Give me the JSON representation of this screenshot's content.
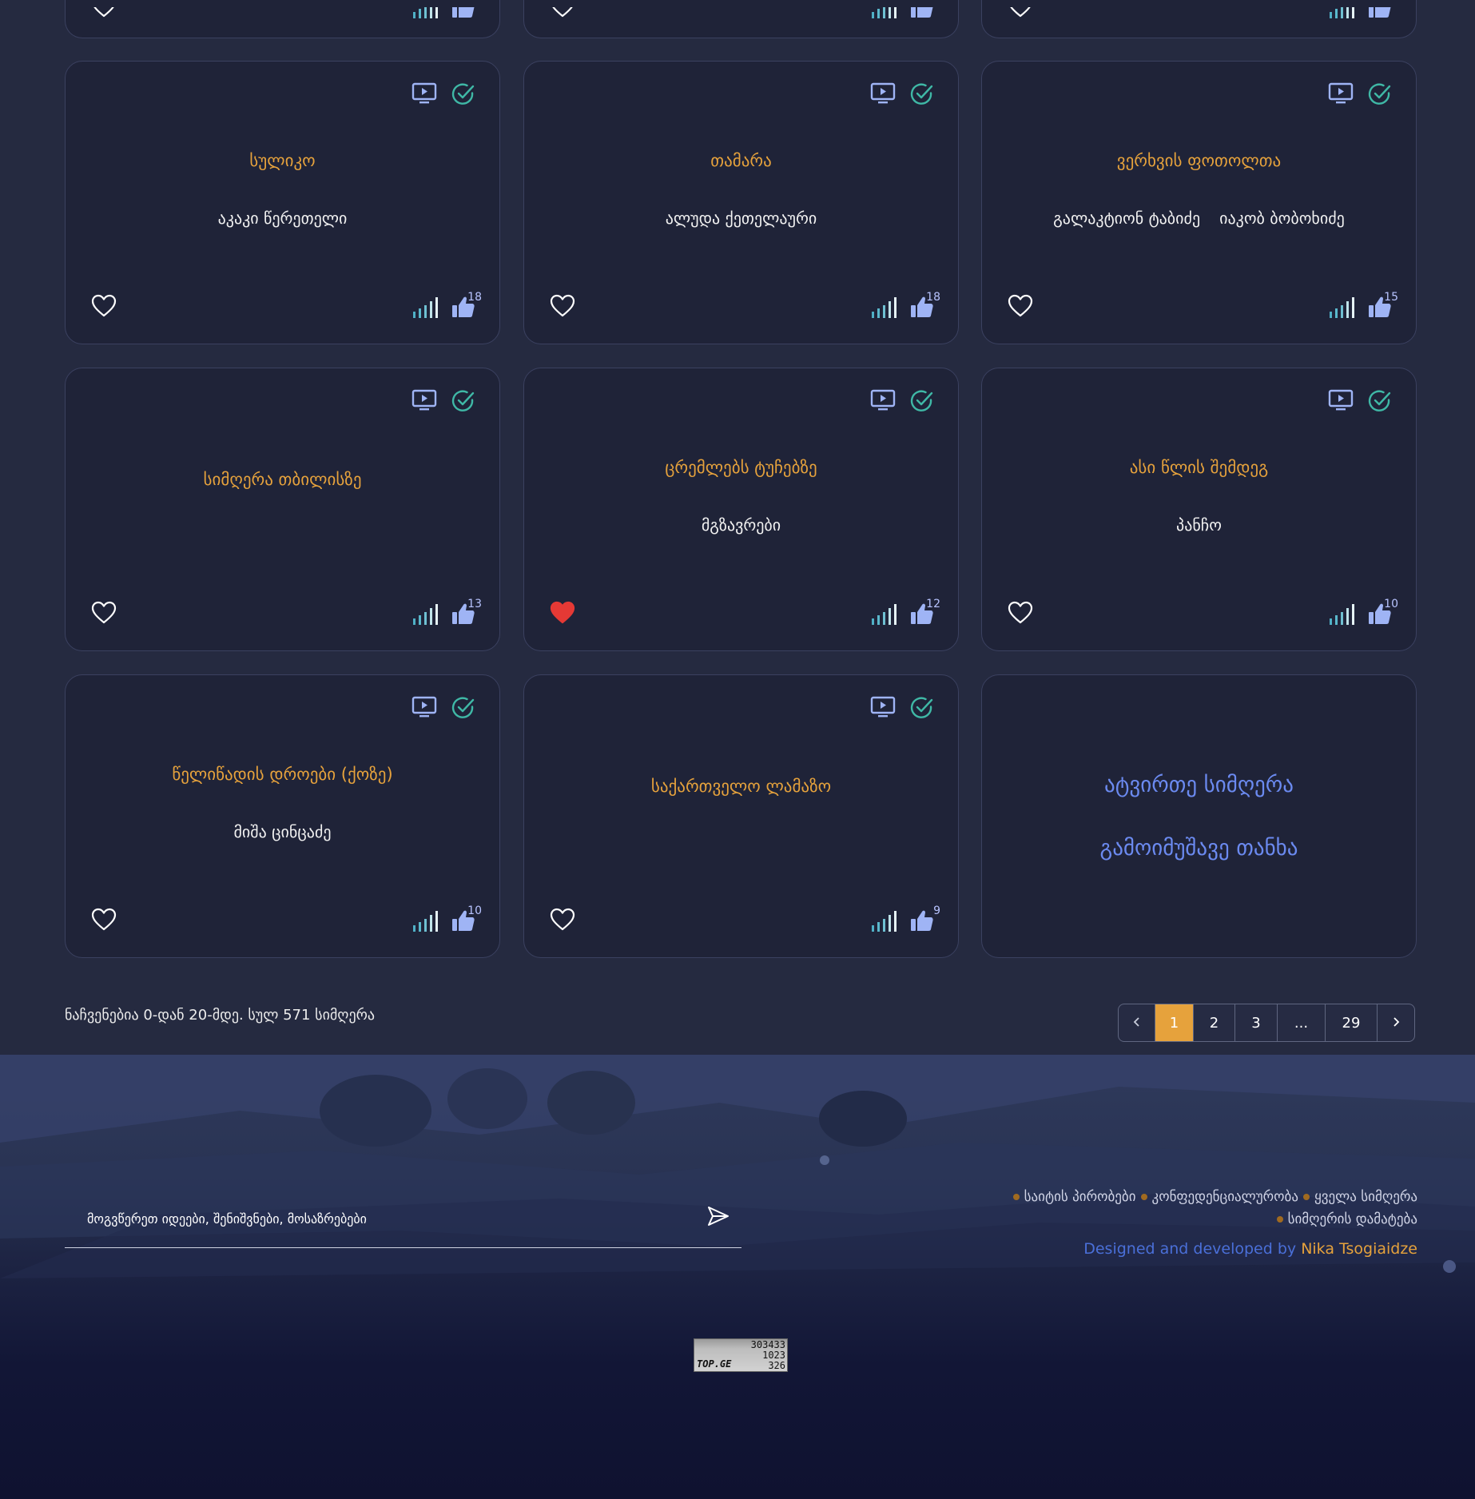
{
  "cards": [
    {
      "title": "სულიკო",
      "artists": [
        "აკაკი წერეთელი"
      ],
      "likes": "18",
      "favorited": false
    },
    {
      "title": "თამარა",
      "artists": [
        "ალუდა ქეთელაური"
      ],
      "likes": "18",
      "favorited": false
    },
    {
      "title": "ვერხვის ფოთოლთა",
      "artists": [
        "გალაკტიონ ტაბიძე",
        "იაკობ ბობოხიძე"
      ],
      "likes": "15",
      "favorited": false
    },
    {
      "title": "სიმღერა თბილისზე",
      "artists": [],
      "likes": "13",
      "favorited": false
    },
    {
      "title": "ცრემლებს ტუჩებზე",
      "artists": [
        "მგზავრები"
      ],
      "likes": "12",
      "favorited": true
    },
    {
      "title": "ასი წლის შემდეგ",
      "artists": [
        "პანჩო"
      ],
      "likes": "10",
      "favorited": false
    },
    {
      "title": "წელიწადის დროები (ქოზე)",
      "artists": [
        "მიშა ცინცაძე"
      ],
      "likes": "10",
      "favorited": false
    },
    {
      "title": "საქართველო ლამაზო",
      "artists": [],
      "likes": "9",
      "favorited": false
    }
  ],
  "promo": {
    "link1": "ატვირთე სიმღერა",
    "link2": "გამოიმუშავე თანხა"
  },
  "status_text": "ნაჩვენებია 0-დან 20-მდე. სულ 571 სიმღერა",
  "pagination": {
    "pages": [
      "1",
      "2",
      "3",
      "...",
      "29"
    ],
    "current": "1",
    "prev_icon": "chevron-left-icon",
    "next_icon": "chevron-right-icon"
  },
  "footer": {
    "feedback_placeholder": "მოგვწერეთ იდეები, შენიშვნები, მოსაზრებები",
    "links": [
      "საიტის პირობები",
      "კონფედენციალურობა",
      "ყველა სიმღერა",
      "სიმღერის დამატება"
    ],
    "credit_prefix": "Designed and developed by",
    "credit_name": "Nika Tsogiaidze",
    "counter": [
      "303433",
      "1023",
      "326"
    ],
    "counter_logo": "TOP.GE"
  },
  "colors": {
    "accent": "#e6a23c",
    "link": "#6b8af0",
    "favorite": "#e53935",
    "check": "#3fb8a6",
    "icon": "#9fb4f5"
  }
}
